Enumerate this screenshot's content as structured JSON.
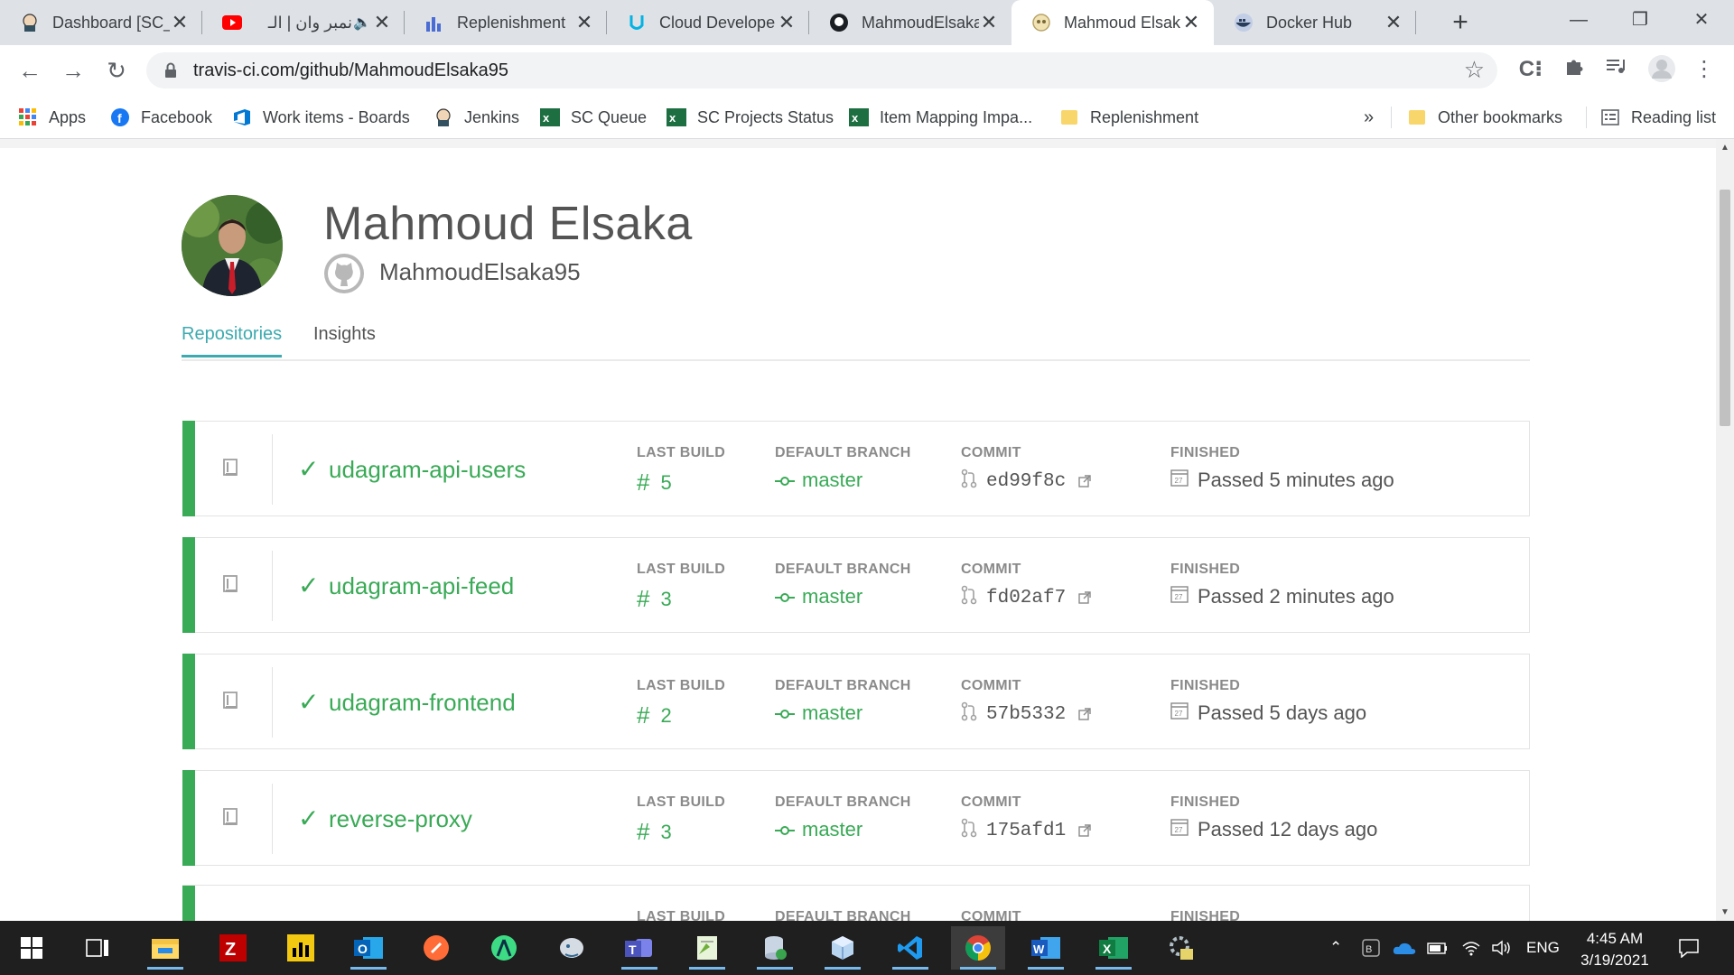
{
  "browser": {
    "tabs": [
      {
        "title": "Dashboard [SC_",
        "icon": "jenkins-icon"
      },
      {
        "title": "نمبر وان | الـ",
        "icon": "youtube-icon"
      },
      {
        "title": "Replenishment",
        "icon": "powerbi-icon"
      },
      {
        "title": "Cloud Develope",
        "icon": "udacity-icon"
      },
      {
        "title": "MahmoudElsaka",
        "icon": "github-icon"
      },
      {
        "title": "Mahmoud Elsak",
        "icon": "travis-icon"
      },
      {
        "title": "Docker Hub",
        "icon": "docker-icon"
      }
    ],
    "url": "travis-ci.com/github/MahmoudElsaka95",
    "bookmarks": [
      {
        "label": "Apps"
      },
      {
        "label": "Facebook"
      },
      {
        "label": "Work items - Boards"
      },
      {
        "label": "Jenkins"
      },
      {
        "label": "SC Queue"
      },
      {
        "label": "SC Projects Status"
      },
      {
        "label": "Item Mapping Impa..."
      },
      {
        "label": "Replenishment"
      }
    ],
    "bookmarks_overflow": "»",
    "other_bookmarks": "Other bookmarks",
    "reading_list": "Reading list"
  },
  "profile": {
    "name": "Mahmoud Elsaka",
    "login": "MahmoudElsaka95",
    "tabs": [
      "Repositories",
      "Insights"
    ]
  },
  "columns": {
    "last_build": "LAST BUILD",
    "default_branch": "DEFAULT BRANCH",
    "commit": "COMMIT",
    "finished": "FINISHED"
  },
  "repos": [
    {
      "name": "udagram-api-users",
      "build": "5",
      "branch": "master",
      "commit": "ed99f8c",
      "finished": "Passed 5 minutes ago",
      "status": "passed"
    },
    {
      "name": "udagram-api-feed",
      "build": "3",
      "branch": "master",
      "commit": "fd02af7",
      "finished": "Passed 2 minutes ago",
      "status": "passed"
    },
    {
      "name": "udagram-frontend",
      "build": "2",
      "branch": "master",
      "commit": "57b5332",
      "finished": "Passed 5 days ago",
      "status": "passed"
    },
    {
      "name": "reverse-proxy",
      "build": "3",
      "branch": "master",
      "commit": "175afd1",
      "finished": "Passed 12 days ago",
      "status": "passed"
    }
  ],
  "calendar_icon_day": "27",
  "colors": {
    "passed": "#39aa56",
    "accent": "#3eaaaf"
  },
  "taskbar": {
    "language": "ENG",
    "time": "4:45 AM",
    "date": "3/19/2021"
  }
}
